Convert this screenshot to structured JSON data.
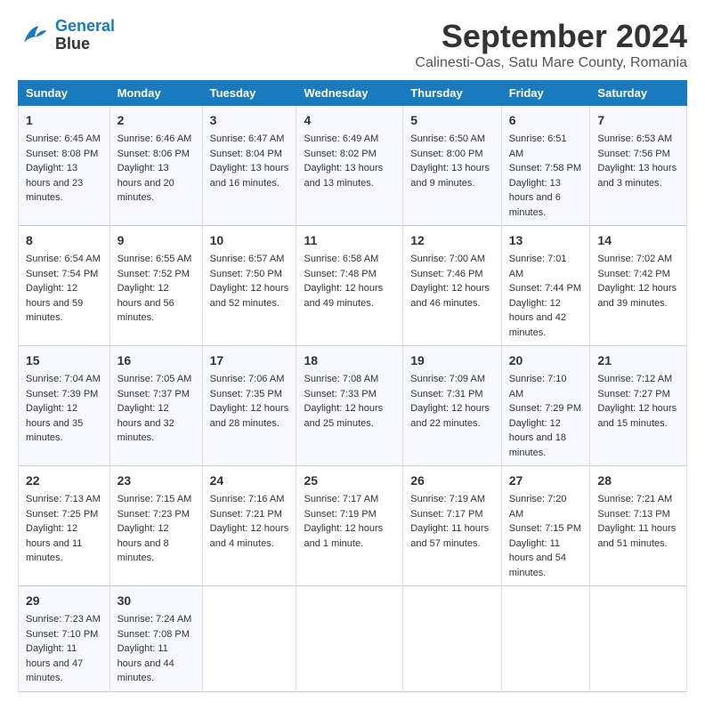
{
  "header": {
    "logo_line1": "General",
    "logo_line2": "Blue",
    "month_title": "September 2024",
    "subtitle": "Calinesti-Oas, Satu Mare County, Romania"
  },
  "weekdays": [
    "Sunday",
    "Monday",
    "Tuesday",
    "Wednesday",
    "Thursday",
    "Friday",
    "Saturday"
  ],
  "weeks": [
    [
      {
        "day": "1",
        "sunrise": "6:45 AM",
        "sunset": "8:08 PM",
        "daylight": "13 hours and 23 minutes."
      },
      {
        "day": "2",
        "sunrise": "6:46 AM",
        "sunset": "8:06 PM",
        "daylight": "13 hours and 20 minutes."
      },
      {
        "day": "3",
        "sunrise": "6:47 AM",
        "sunset": "8:04 PM",
        "daylight": "13 hours and 16 minutes."
      },
      {
        "day": "4",
        "sunrise": "6:49 AM",
        "sunset": "8:02 PM",
        "daylight": "13 hours and 13 minutes."
      },
      {
        "day": "5",
        "sunrise": "6:50 AM",
        "sunset": "8:00 PM",
        "daylight": "13 hours and 9 minutes."
      },
      {
        "day": "6",
        "sunrise": "6:51 AM",
        "sunset": "7:58 PM",
        "daylight": "13 hours and 6 minutes."
      },
      {
        "day": "7",
        "sunrise": "6:53 AM",
        "sunset": "7:56 PM",
        "daylight": "13 hours and 3 minutes."
      }
    ],
    [
      {
        "day": "8",
        "sunrise": "6:54 AM",
        "sunset": "7:54 PM",
        "daylight": "12 hours and 59 minutes."
      },
      {
        "day": "9",
        "sunrise": "6:55 AM",
        "sunset": "7:52 PM",
        "daylight": "12 hours and 56 minutes."
      },
      {
        "day": "10",
        "sunrise": "6:57 AM",
        "sunset": "7:50 PM",
        "daylight": "12 hours and 52 minutes."
      },
      {
        "day": "11",
        "sunrise": "6:58 AM",
        "sunset": "7:48 PM",
        "daylight": "12 hours and 49 minutes."
      },
      {
        "day": "12",
        "sunrise": "7:00 AM",
        "sunset": "7:46 PM",
        "daylight": "12 hours and 46 minutes."
      },
      {
        "day": "13",
        "sunrise": "7:01 AM",
        "sunset": "7:44 PM",
        "daylight": "12 hours and 42 minutes."
      },
      {
        "day": "14",
        "sunrise": "7:02 AM",
        "sunset": "7:42 PM",
        "daylight": "12 hours and 39 minutes."
      }
    ],
    [
      {
        "day": "15",
        "sunrise": "7:04 AM",
        "sunset": "7:39 PM",
        "daylight": "12 hours and 35 minutes."
      },
      {
        "day": "16",
        "sunrise": "7:05 AM",
        "sunset": "7:37 PM",
        "daylight": "12 hours and 32 minutes."
      },
      {
        "day": "17",
        "sunrise": "7:06 AM",
        "sunset": "7:35 PM",
        "daylight": "12 hours and 28 minutes."
      },
      {
        "day": "18",
        "sunrise": "7:08 AM",
        "sunset": "7:33 PM",
        "daylight": "12 hours and 25 minutes."
      },
      {
        "day": "19",
        "sunrise": "7:09 AM",
        "sunset": "7:31 PM",
        "daylight": "12 hours and 22 minutes."
      },
      {
        "day": "20",
        "sunrise": "7:10 AM",
        "sunset": "7:29 PM",
        "daylight": "12 hours and 18 minutes."
      },
      {
        "day": "21",
        "sunrise": "7:12 AM",
        "sunset": "7:27 PM",
        "daylight": "12 hours and 15 minutes."
      }
    ],
    [
      {
        "day": "22",
        "sunrise": "7:13 AM",
        "sunset": "7:25 PM",
        "daylight": "12 hours and 11 minutes."
      },
      {
        "day": "23",
        "sunrise": "7:15 AM",
        "sunset": "7:23 PM",
        "daylight": "12 hours and 8 minutes."
      },
      {
        "day": "24",
        "sunrise": "7:16 AM",
        "sunset": "7:21 PM",
        "daylight": "12 hours and 4 minutes."
      },
      {
        "day": "25",
        "sunrise": "7:17 AM",
        "sunset": "7:19 PM",
        "daylight": "12 hours and 1 minute."
      },
      {
        "day": "26",
        "sunrise": "7:19 AM",
        "sunset": "7:17 PM",
        "daylight": "11 hours and 57 minutes."
      },
      {
        "day": "27",
        "sunrise": "7:20 AM",
        "sunset": "7:15 PM",
        "daylight": "11 hours and 54 minutes."
      },
      {
        "day": "28",
        "sunrise": "7:21 AM",
        "sunset": "7:13 PM",
        "daylight": "11 hours and 51 minutes."
      }
    ],
    [
      {
        "day": "29",
        "sunrise": "7:23 AM",
        "sunset": "7:10 PM",
        "daylight": "11 hours and 47 minutes."
      },
      {
        "day": "30",
        "sunrise": "7:24 AM",
        "sunset": "7:08 PM",
        "daylight": "11 hours and 44 minutes."
      },
      null,
      null,
      null,
      null,
      null
    ]
  ]
}
